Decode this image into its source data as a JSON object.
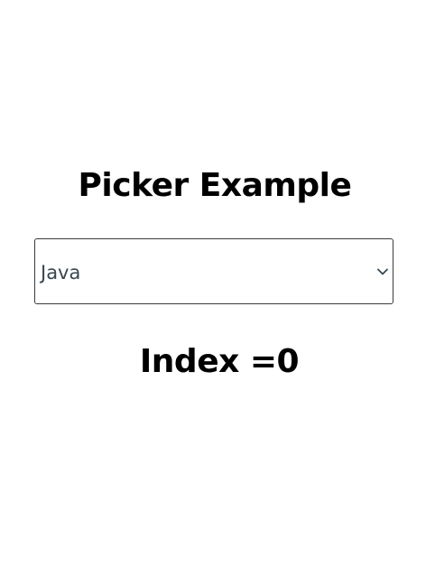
{
  "header": {
    "title": "Picker Example"
  },
  "picker": {
    "selected_value": "Java",
    "chevron_icon": "chevron-down-icon",
    "border_color": "#3a3a3a",
    "text_color": "#37474f"
  },
  "result": {
    "index_text": "Index =0"
  }
}
